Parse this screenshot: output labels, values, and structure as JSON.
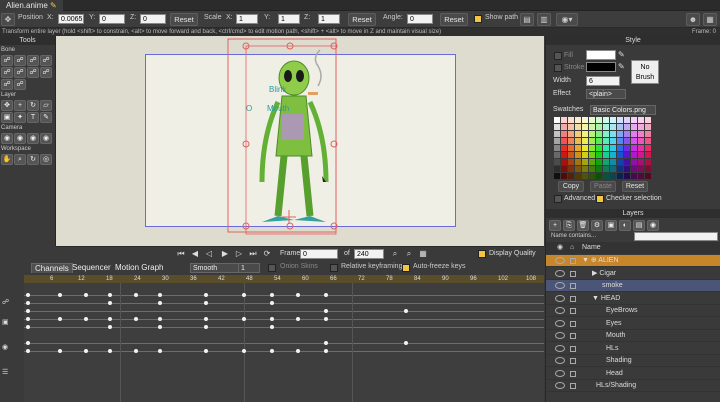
{
  "window": {
    "tab_title": "Alien.anime",
    "tab_modified": "✎"
  },
  "toolbar": {
    "position_label": "Position",
    "x_label": "X:",
    "x_value": "0.0065",
    "y_label": "Y:",
    "y_value": "0",
    "z_label": "Z:",
    "z_value": "0",
    "reset1": "Reset",
    "scale_label": "Scale",
    "sx_label": "X:",
    "sx_value": "1",
    "sy_label": "Y:",
    "sy_value": "1",
    "sz_label": "Z:",
    "sz_value": "1",
    "reset2": "Reset",
    "angle_label": "Angle:",
    "angle_value": "0",
    "reset3": "Reset",
    "show_path": "Show path"
  },
  "status": {
    "hint": "Transform entire layer (hold <shift> to constrain, <alt> to move forward and back, <ctrl/cmd> to edit motion path, <shift> + <alt> to move in Z and maintain visual size)",
    "frame": "Frame: 0"
  },
  "tools": {
    "title": "Tools",
    "bone": "Bone",
    "layer": "Layer",
    "camera": "Camera",
    "workspace": "Workspace"
  },
  "canvas": {
    "label_blink": "Blink",
    "label_o": "O",
    "label_mouth": "Mouth"
  },
  "playbar": {
    "frame_label": "Frame",
    "frame_value": "0",
    "of_label": "of",
    "total": "240",
    "display_quality": "Display Quality"
  },
  "timeline": {
    "tabs": [
      "Channels",
      "Sequencer",
      "Motion Graph"
    ],
    "interp": "Smooth",
    "interp_num": "1",
    "onion": "Onion Skins",
    "relative": "Relative keyframing",
    "autofreeze": "Auto-freeze keys",
    "ticks": [
      "6",
      "12",
      "18",
      "24",
      "30",
      "36",
      "42",
      "48",
      "54",
      "60",
      "66",
      "72",
      "78",
      "84",
      "90",
      "96",
      "102",
      "108"
    ]
  },
  "style": {
    "title": "Style",
    "fill": "Fill",
    "stroke": "Stroke",
    "width_label": "Width",
    "width_value": "6",
    "effect_label": "Effect",
    "effect_value": "<plain>",
    "no_brush": "No Brush",
    "swatches_label": "Swatches",
    "swatches_file": "Basic Colors.png",
    "copy": "Copy",
    "paste": "Paste",
    "reset": "Reset",
    "advanced": "Advanced",
    "checker": "Checker selection"
  },
  "layers": {
    "title": "Layers",
    "search_placeholder": "Name contains...",
    "col_name": "Name",
    "rows": [
      "ALIEN",
      "Cigar",
      "smoke",
      "HEAD",
      "EyeBrows",
      "Eyes",
      "Mouth",
      "HLs",
      "Shading",
      "Head",
      "HLs/Shading"
    ]
  }
}
